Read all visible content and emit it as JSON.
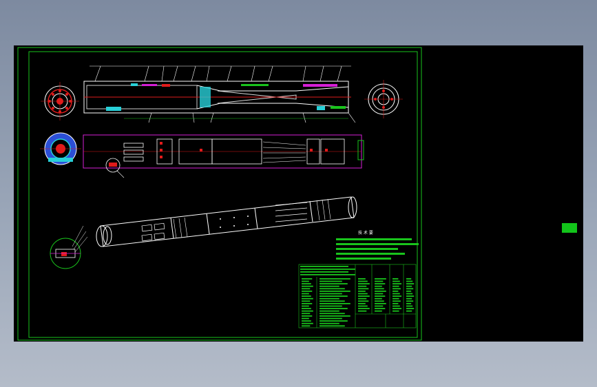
{
  "drawing": {
    "notes_heading": "技 术 要",
    "line_color": "#ffffff",
    "frame_color": "#19c41c",
    "accent_magenta": "#d61fd6",
    "accent_red": "#e11b1b",
    "accent_cyan": "#28d0d8",
    "accent_blue": "#2b4fd6"
  },
  "side_tag": {
    "label": ""
  }
}
